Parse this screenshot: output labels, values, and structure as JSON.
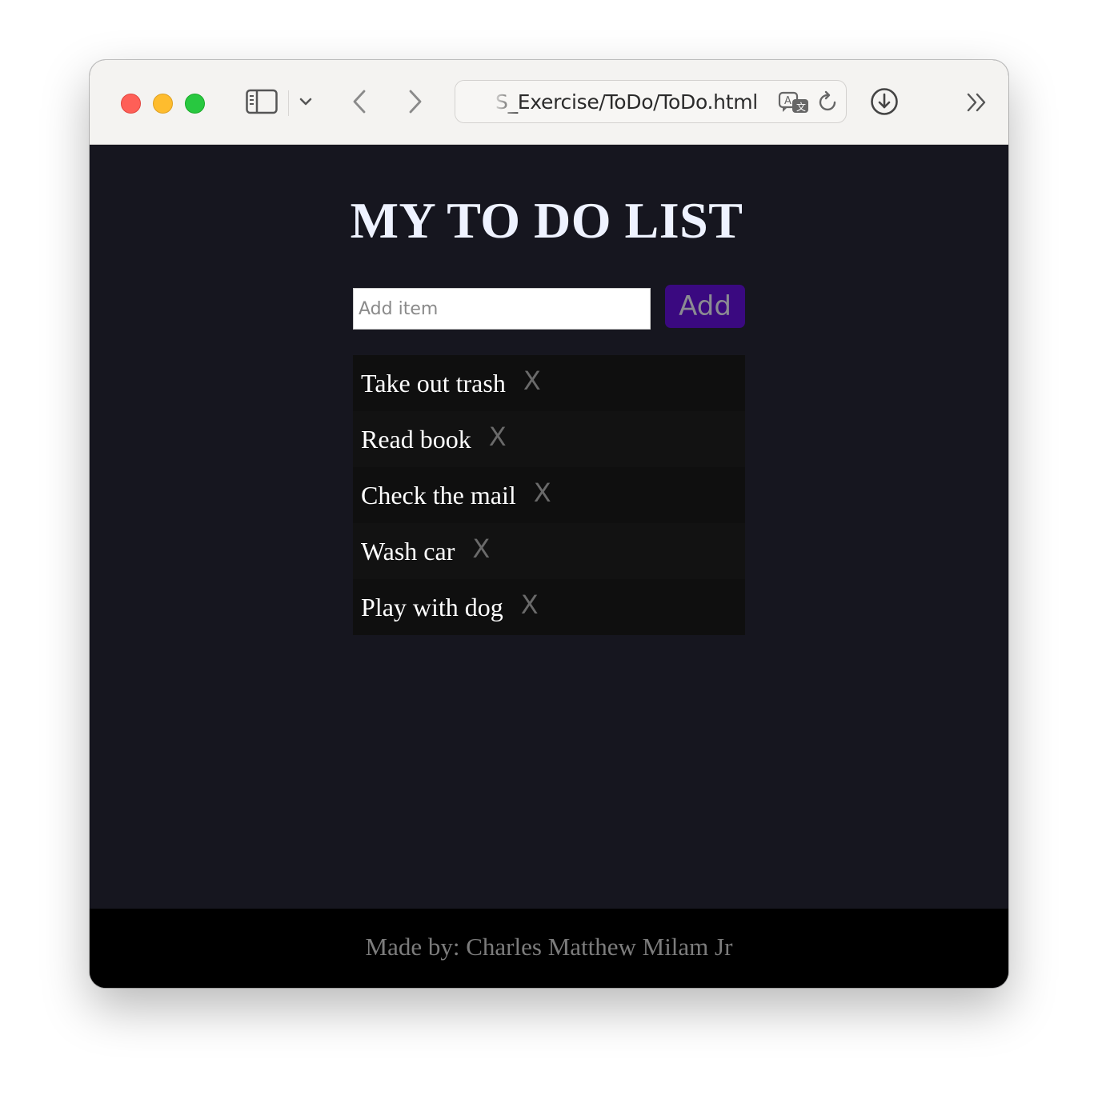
{
  "browser": {
    "url": "S_Exercise/ToDo/ToDo.html"
  },
  "page": {
    "title": "MY TO DO LIST",
    "input_placeholder": "Add item",
    "add_label": "Add",
    "items": [
      {
        "text": "Take out trash",
        "delete": "X"
      },
      {
        "text": "Read book",
        "delete": "X"
      },
      {
        "text": "Check the mail",
        "delete": "X"
      },
      {
        "text": "Wash car",
        "delete": "X"
      },
      {
        "text": "Play with dog",
        "delete": "X"
      }
    ],
    "footer": "Made by: Charles Matthew Milam Jr"
  },
  "colors": {
    "page_background": "#16161f",
    "add_button": "#3a0980",
    "footer_background": "#000000",
    "delete_x": "#6a6a6a"
  },
  "icons": [
    "sidebar-icon",
    "chevron-down-icon",
    "back-icon",
    "forward-icon",
    "translate-icon",
    "reload-icon",
    "download-icon",
    "more-icon"
  ]
}
